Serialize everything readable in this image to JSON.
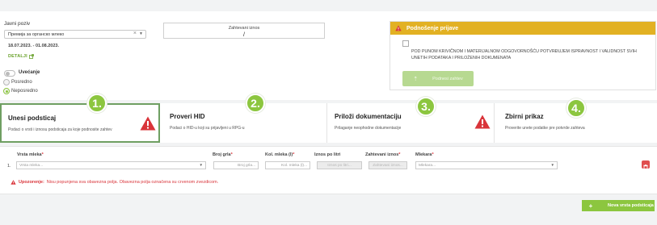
{
  "program": {
    "label": "Javni poziv",
    "selected": "Премија за органско млеко",
    "dates": "18.07.2023. - 01.08.2023.",
    "details_link": "DETALJI"
  },
  "options": {
    "toggle_label": "Uvećanje",
    "radio_posredno": "Posredno",
    "radio_neposredno": "Neposredno",
    "selected": "Neposredno"
  },
  "amount": {
    "label": "Zahtevani iznos",
    "value": "/"
  },
  "submission": {
    "title": "Podnošenje prijave",
    "declaration": "POD PUNOM KRIVIČNOM I MATERIJALNOM ODGOVORNOŠĆU POTVRĐUJEM ISPRAVNOST I VALIDNOST SVIH UNETIH PODATAKA I PRILOŽENIH DOKUMENATA",
    "button_label": "Podnesi zahtev"
  },
  "steps": [
    {
      "number": "1.",
      "title": "Unesi podsticaj",
      "desc": "Podaci o vrsti i iznosu podsticaja za koje podnosite zahtev",
      "warning": true,
      "active": true
    },
    {
      "number": "2.",
      "title": "Proveri HID",
      "desc": "Podaci o HID-u koji su prijavljeni u RPG-u",
      "warning": false,
      "active": false
    },
    {
      "number": "3.",
      "title": "Priloži dokumentaciju",
      "desc": "Prilaganje neophodne dokumentacije",
      "warning": true,
      "active": false
    },
    {
      "number": "4.",
      "title": "Zbirni prikaz",
      "desc": "Proverite unete podatke pre potvrde zahteva",
      "warning": false,
      "active": false
    }
  ],
  "form": {
    "row_number": "1.",
    "columns": {
      "vrsta_mleka": "Vrsta mleka",
      "broj_grla": "Broj grla",
      "kol_mleka": "Kol. mleka (l)",
      "iznos_po_litri": "Iznos po litri",
      "zahtevani_iznos": "Zahtevani iznos",
      "mlekara": "Mlekara"
    },
    "placeholders": {
      "vrsta_mleka": "Vrsta mleka...",
      "broj_grla": "Broj grla...",
      "kol_mleka": "Kol. mleka (l)...",
      "iznos_po_litri": "Iznos po litri...",
      "zahtevani_iznos": "Zahtevani iznos...",
      "mlekara": "Mlekara..."
    },
    "required_mark": "*",
    "warning_prefix": "Upozorenje:",
    "warning_text": "Nisu popunjena sva obavezna polja. Obavezna polja označena su crvenom zvezdicom."
  },
  "actions": {
    "new_button": "Nova vrsta podsticaja"
  },
  "colors": {
    "accent_green": "#8cc63f",
    "warning_yellow": "#e2b123",
    "error_red": "#d9343a"
  }
}
